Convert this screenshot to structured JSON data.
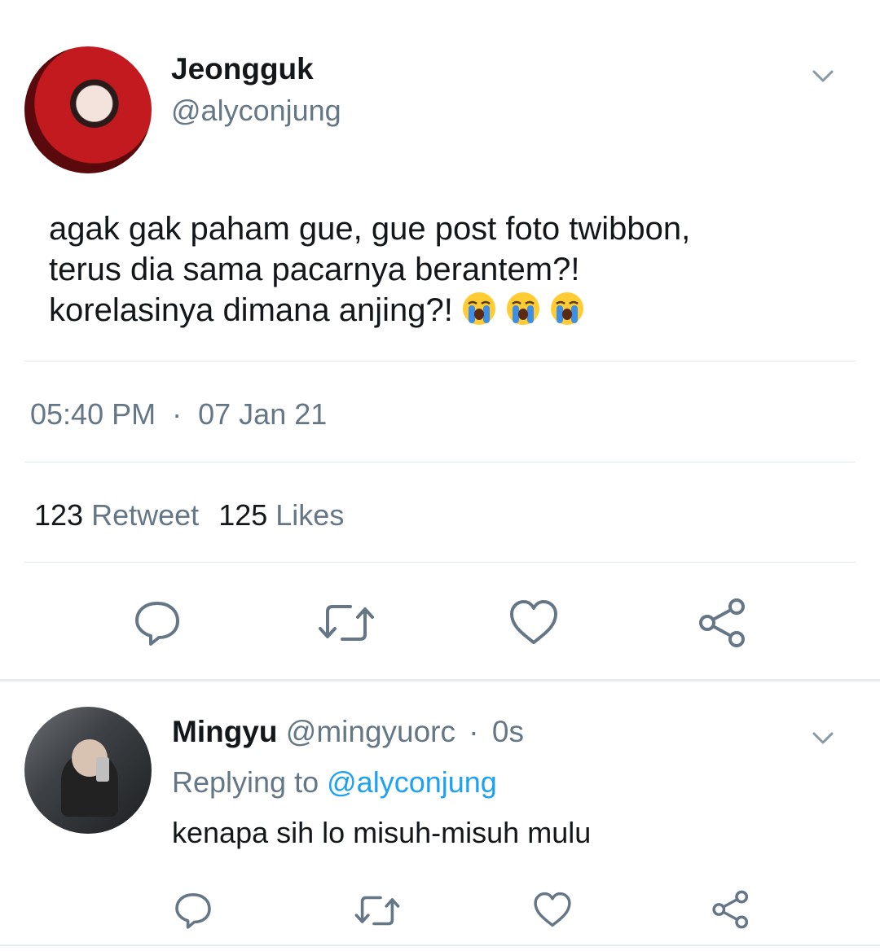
{
  "tweet": {
    "author": {
      "name": "Jeongguk",
      "handle": "@alyconjung",
      "avatar_icon": "avatar-photo"
    },
    "text_lines": [
      "agak gak paham gue, gue post foto twibbon,",
      "terus dia sama pacarnya berantem?!",
      "korelasinya dimana anjing?!"
    ],
    "emoji": [
      "loudly-crying-face",
      "loudly-crying-face",
      "loudly-crying-face"
    ],
    "time": "05:40 PM",
    "separator": "·",
    "date": "07 Jan 21",
    "stats": {
      "retweets_count": "123",
      "retweets_label": "Retweet",
      "likes_count": "125",
      "likes_label": "Likes"
    },
    "actions": [
      "reply-icon",
      "retweet-icon",
      "like-icon",
      "share-icon"
    ]
  },
  "reply": {
    "author": {
      "name": "Mingyu",
      "handle": "@mingyuorc",
      "separator": "·",
      "time": "0s"
    },
    "replying_prefix": "Replying to",
    "replying_handle": "@alyconjung",
    "text": "kenapa sih lo misuh-misuh mulu",
    "actions": [
      "reply-icon",
      "retweet-icon",
      "like-icon",
      "share-icon"
    ]
  },
  "colors": {
    "text": "#14171a",
    "muted": "#657786",
    "link": "#1da1f2",
    "icon": "#657786",
    "divider": "#e1e8ed"
  }
}
